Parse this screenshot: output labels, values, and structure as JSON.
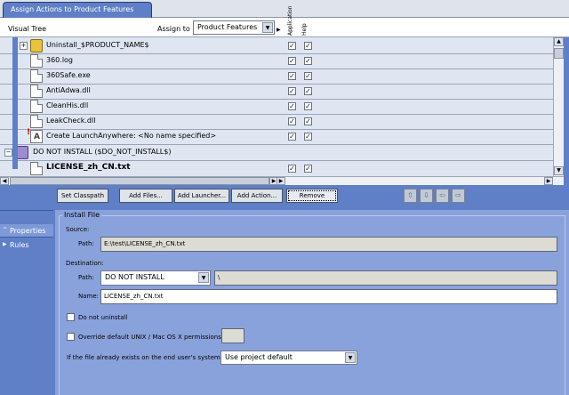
{
  "tab": {
    "label": "Assign Actions to Product Features"
  },
  "header": {
    "visual_tree": "Visual Tree",
    "assign_to": "Assign to",
    "assign_select": "Product Features",
    "columns": [
      "Application",
      "Help"
    ]
  },
  "tree": {
    "rows": [
      {
        "label": "Uninstall_$PRODUCT_NAME$",
        "icon": "folder-icon",
        "expander": "+",
        "app": true,
        "help": true
      },
      {
        "label": "360.log",
        "icon": "file-icon",
        "app": true,
        "help": true
      },
      {
        "label": "360Safe.exe",
        "icon": "file-icon",
        "app": true,
        "help": true
      },
      {
        "label": "AntiAdwa.dll",
        "icon": "file-icon",
        "app": true,
        "help": true
      },
      {
        "label": "CleanHis.dll",
        "icon": "file-icon",
        "app": true,
        "help": true
      },
      {
        "label": "LeakCheck.dll",
        "icon": "file-icon",
        "app": true,
        "help": true
      },
      {
        "label": "Create LaunchAnywhere: <No name specified>",
        "icon": "launcher-icon",
        "app": true,
        "help": true
      },
      {
        "label": "DO NOT INSTALL ($DO_NOT_INSTALL$)",
        "icon": "folder-icon",
        "expander": "−"
      },
      {
        "label": "LICENSE_zh_CN.txt",
        "icon": "file-icon",
        "app": true,
        "help": true,
        "selected": true
      }
    ]
  },
  "buttons": {
    "set_classpath": "Set Classpath",
    "add_files": "Add Files...",
    "add_launcher": "Add Launcher...",
    "add_action": "Add Action...",
    "remove": "Remove"
  },
  "nav": {
    "items": [
      {
        "label": "Properties",
        "active": true
      },
      {
        "label": "Rules",
        "active": false
      }
    ]
  },
  "install_file": {
    "title": "Install File",
    "source_label": "Source:",
    "path_label": "Path:",
    "source_path": "E:\\test\\LICENSE_zh_CN.txt",
    "destination_label": "Destination:",
    "dest_path_label": "Path:",
    "dest_path_select": "DO NOT INSTALL",
    "dest_path_suffix": "\\",
    "name_label": "Name:",
    "name_value": "LICENSE_zh_CN.txt",
    "do_not_uninstall": "Do not uninstall",
    "override_permissions": "Override default UNIX / Mac OS X permissions:",
    "exists_label": "If the file already exists on the end user's system:",
    "exists_select": "Use project default"
  },
  "colors": {
    "frame_blue": "#5f7fc6",
    "panel_blue": "#8aa2dc",
    "tree_bg": "#dfe6f2"
  }
}
